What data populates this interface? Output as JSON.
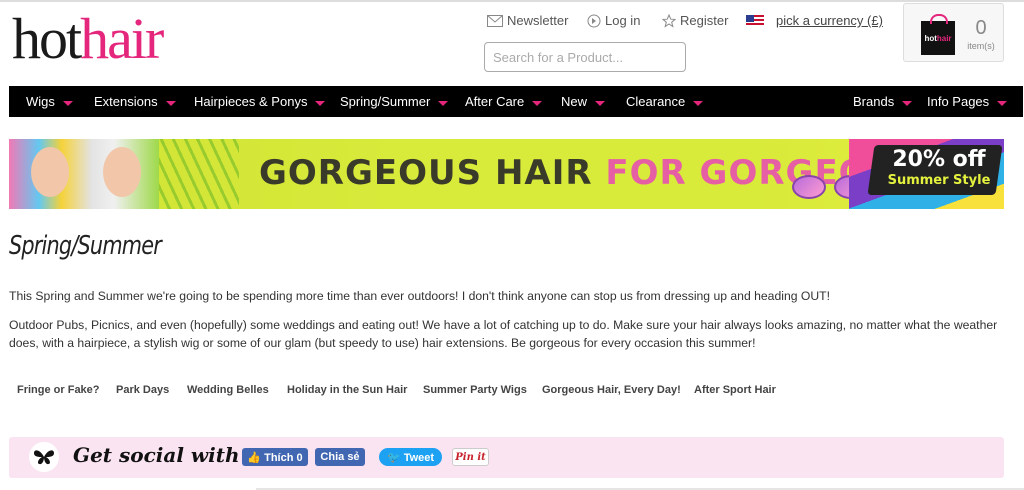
{
  "logo": {
    "part1": "hot",
    "part2": "hair"
  },
  "header": {
    "newsletter": "Newsletter",
    "login": "Log in",
    "register": "Register",
    "currency": "pick a currency (£)",
    "search_placeholder": "Search for a Product...",
    "cart": {
      "count": "0",
      "label": "item(s)",
      "bag_text_1": "hot",
      "bag_text_2": "hair"
    }
  },
  "nav": {
    "left": [
      "Wigs",
      "Extensions",
      "Hairpieces & Ponys",
      "Spring/Summer",
      "After Care",
      "New",
      "Clearance"
    ],
    "right": [
      "Brands",
      "Info Pages"
    ]
  },
  "banner": {
    "headline_1": "GORGEOUS HAIR",
    "headline_2": "FOR GORGEOUS HAIR",
    "badge_1": "20% off",
    "badge_2": "Summer Style"
  },
  "page": {
    "title": "Spring/Summer",
    "paragraph_1": "This Spring and Summer we're going to be spending more time than ever outdoors!  I don't think anyone can stop us from dressing up and heading OUT!",
    "paragraph_2": "Outdoor Pubs, Picnics, and even (hopefully) some weddings and eating out! We have a lot of catching up to do. Make sure your hair always looks amazing, no matter what the weather does, with a hairpiece, a stylish wig or some of our glam (but speedy to use) hair extensions. Be gorgeous for every occasion this summer!"
  },
  "sublinks": [
    "Fringe or Fake?",
    "Park Days",
    "Wedding Belles",
    "Holiday in the Sun Hair",
    "Summer Party Wigs",
    "Gorgeous Hair, Every Day!",
    "After Sport Hair"
  ],
  "social": {
    "heading": "Get social with us:",
    "fb_like": "👍 Thích 0",
    "fb_share": "Chia sẻ",
    "tweet": "🐦 Tweet",
    "pin": "Pin it"
  },
  "colors": {
    "brand_pink": "#e4267d",
    "nav_bg": "#000000",
    "social_bg": "#fbe4f1"
  }
}
